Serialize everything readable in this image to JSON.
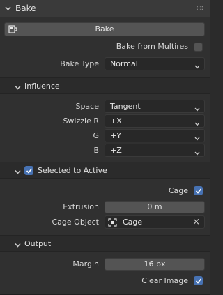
{
  "panel": {
    "title": "Bake",
    "grip": "::::"
  },
  "bake_button": {
    "label": "Bake"
  },
  "bake_from_multires": {
    "label": "Bake from Multires",
    "checked": false
  },
  "bake_type": {
    "label": "Bake Type",
    "value": "Normal"
  },
  "influence": {
    "title": "Influence",
    "space": {
      "label": "Space",
      "value": "Tangent"
    },
    "swizzle_r": {
      "label": "Swizzle R",
      "value": "+X"
    },
    "swizzle_g": {
      "label": "G",
      "value": "+Y"
    },
    "swizzle_b": {
      "label": "B",
      "value": "+Z"
    }
  },
  "selected_to_active": {
    "title": "Selected to Active",
    "checked": true,
    "cage": {
      "label": "Cage",
      "checked": true
    },
    "extrusion": {
      "label": "Extrusion",
      "value": "0 m"
    },
    "cage_object": {
      "label": "Cage Object",
      "value": "Cage",
      "clear": "×"
    }
  },
  "output": {
    "title": "Output",
    "margin": {
      "label": "Margin",
      "value": "16 px"
    },
    "clear_image": {
      "label": "Clear Image",
      "checked": true
    }
  },
  "colors": {
    "accent": "#4772b3",
    "field": "#545454",
    "dropdown": "#282828",
    "bg": "#303030"
  }
}
